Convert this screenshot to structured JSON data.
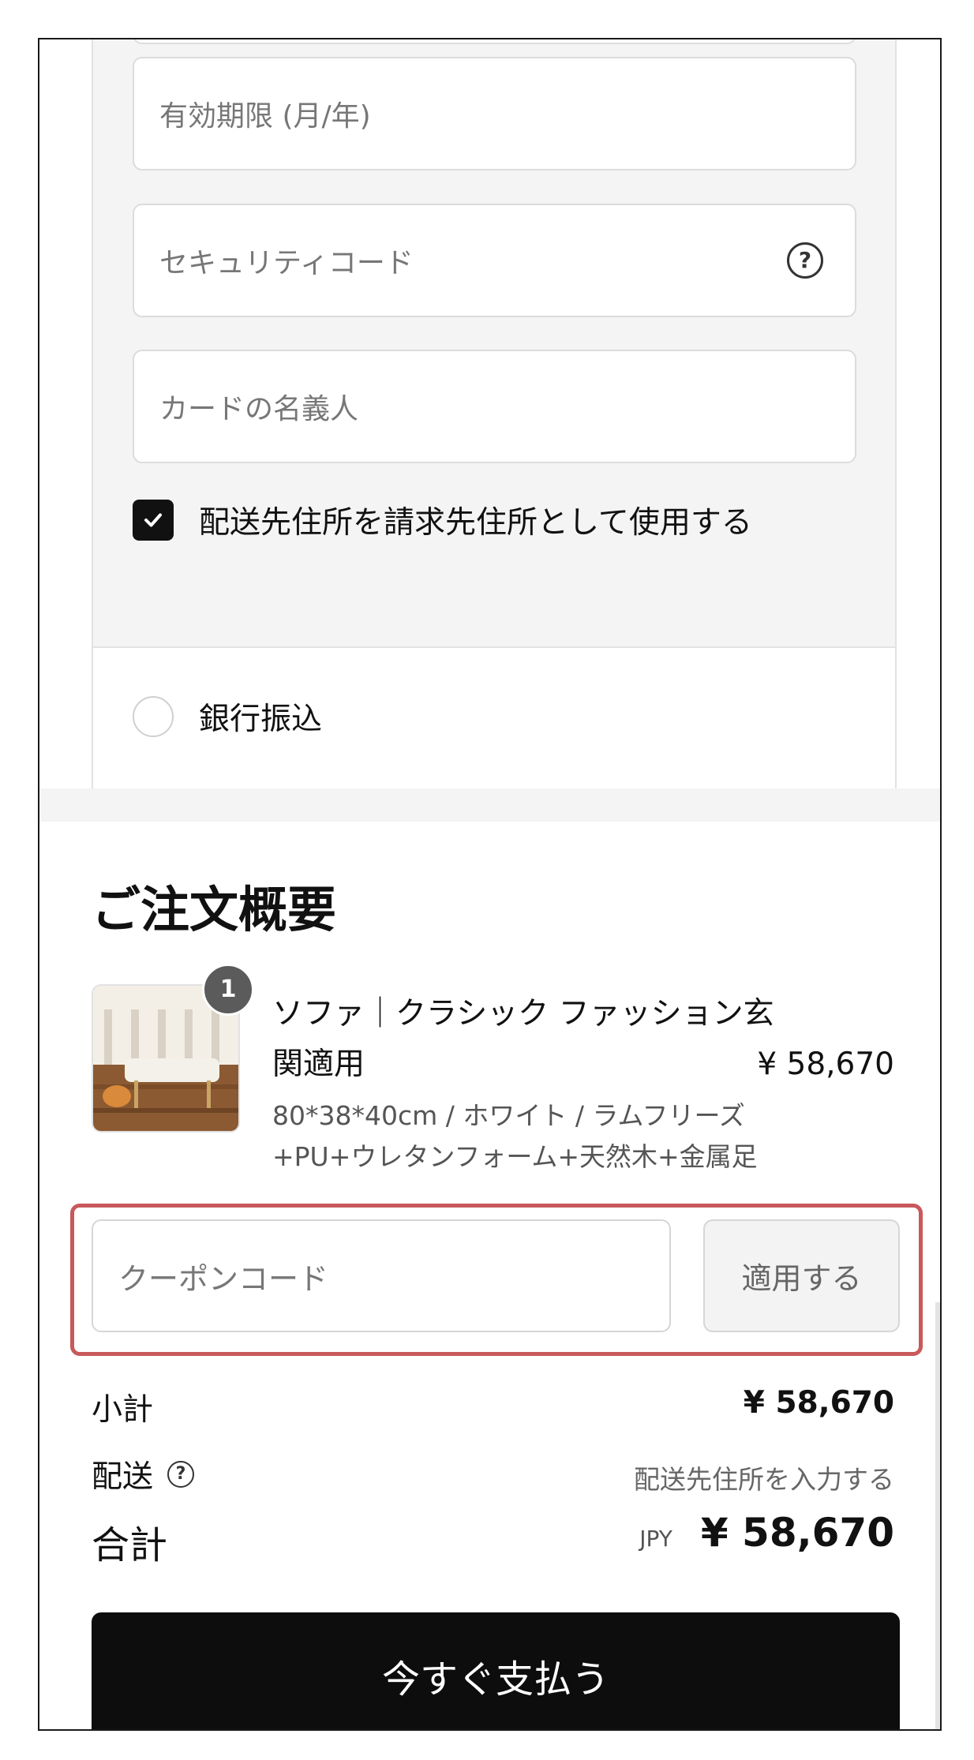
{
  "payment": {
    "expiry_placeholder": "有効期限 (月/年)",
    "security_placeholder": "セキュリティコード",
    "security_help_icon": "?",
    "name_placeholder": "カードの名義人",
    "billing_same_label": "配送先住所を請求先住所として使用する",
    "billing_same_checked": true,
    "bank_transfer_label": "銀行振込"
  },
  "summary": {
    "title": "ご注文概要",
    "product": {
      "quantity": "1",
      "name": "ソファ｜クラシック ファッション玄関適用",
      "price": "¥ 58,670",
      "variant": "80*38*40cm / ホワイト / ラムフリーズ+PU+ウレタンフォーム+天然木+金属足"
    },
    "coupon_placeholder": "クーポンコード",
    "apply_label": "適用する",
    "subtotal_label": "小計",
    "subtotal_value": "¥ 58,670",
    "shipping_label": "配送",
    "shipping_help_icon": "?",
    "shipping_value": "配送先住所を入力する",
    "total_label": "合計",
    "total_currency": "JPY",
    "total_value": "¥ 58,670",
    "pay_button_label": "今すぐ支払う"
  },
  "colors": {
    "highlight": "#c8595b",
    "pay_button": "#0d0d0d",
    "panel_bg": "#f4f4f4"
  }
}
